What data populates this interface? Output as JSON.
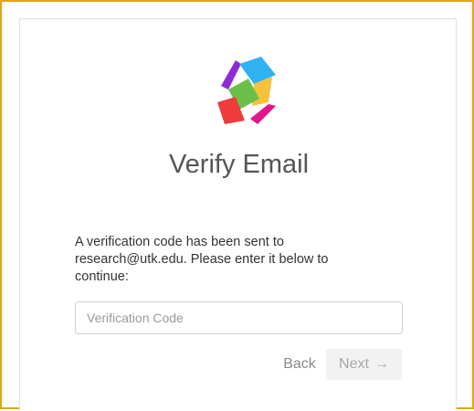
{
  "logo": {
    "icon": "app-logo-icon",
    "colors": {
      "purple": "#8e2bd6",
      "blue": "#2fb3f0",
      "green": "#6cc04a",
      "yellow": "#f7c23b",
      "red": "#ef3b3b",
      "magenta": "#e4148c"
    }
  },
  "page": {
    "title": "Verify Email",
    "message_line1": "A verification code has been sent to",
    "message_line2": "research@utk.edu. Please enter it below to",
    "message_line3": "continue:"
  },
  "form": {
    "code_placeholder": "Verification Code",
    "code_value": ""
  },
  "actions": {
    "back_label": "Back",
    "next_label": "Next",
    "next_arrow": "→"
  }
}
